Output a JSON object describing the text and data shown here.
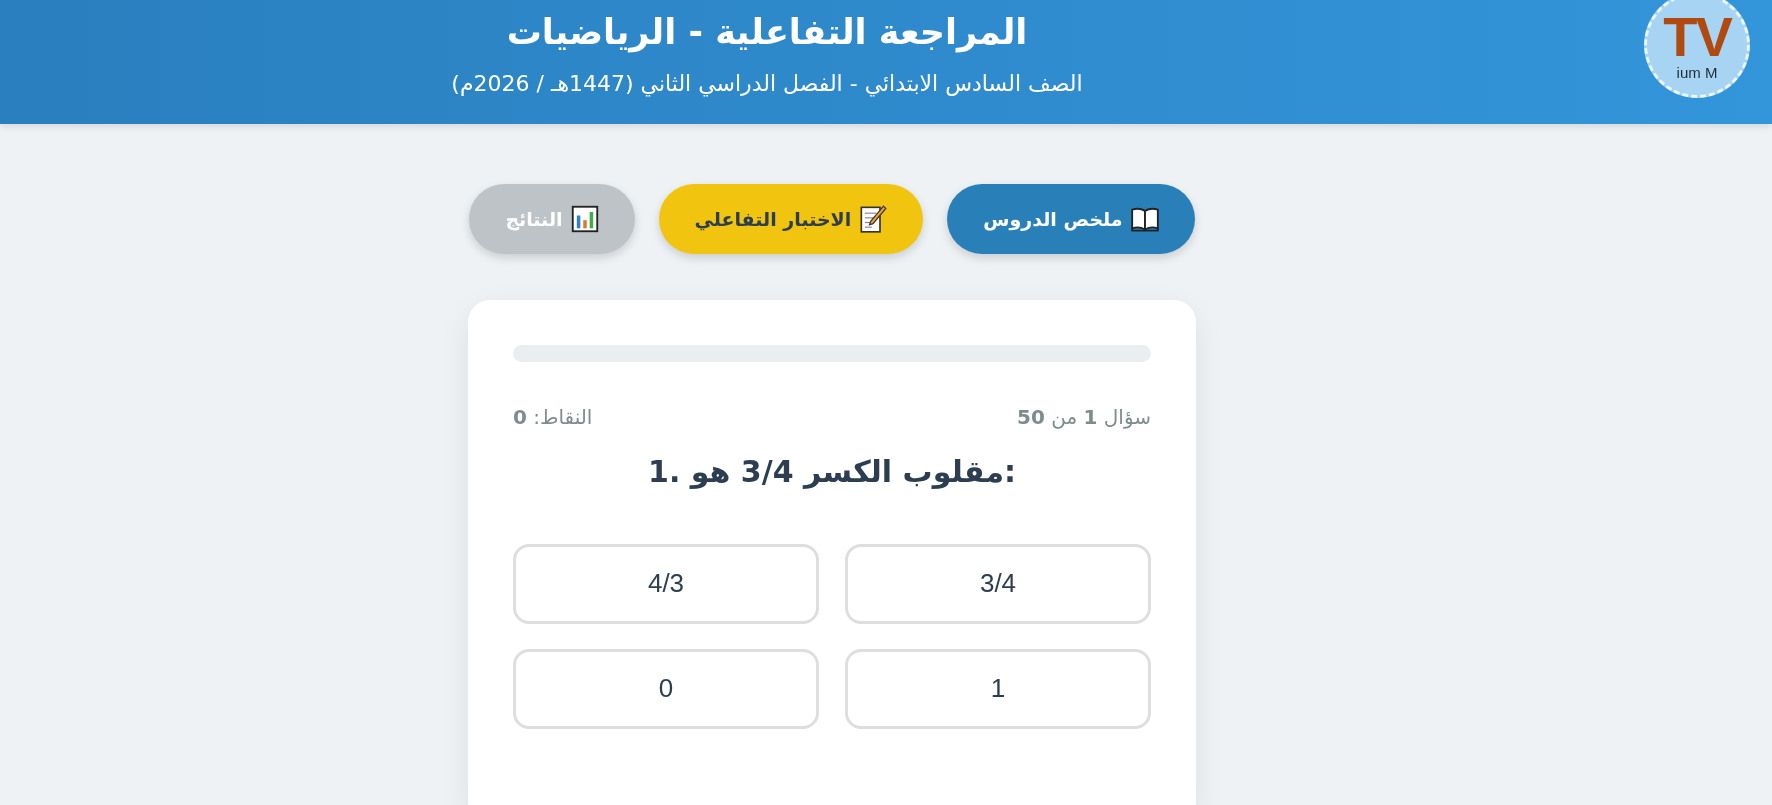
{
  "header": {
    "title": "المراجعة التفاعلية - الرياضيات",
    "subtitle": "الصف السادس الابتدائي - الفصل الدراسي الثاني (1447هـ / 2026م)",
    "logo": {
      "mark": "TV",
      "caption": "ium M"
    }
  },
  "tabs": [
    {
      "label": "ملخص الدروس",
      "color": "#2980b9",
      "selected": false
    },
    {
      "label": "الاختبار التفاعلي",
      "color": "#f1c40f",
      "selected": true
    },
    {
      "label": "النتائج",
      "color": "#bdc3c7",
      "selected": false
    }
  ],
  "quiz": {
    "progress": {
      "level": 0
    },
    "counter": "سؤال **1** من **50**",
    "score": "النقاط: **0**",
    "question": "1. مقلوب الكسر 3/4 هو:",
    "options": [
      {
        "label": "3/4",
        "selected": false
      },
      {
        "label": "4/3",
        "selected": false
      },
      {
        "label": "1",
        "selected": false
      },
      {
        "label": "0",
        "selected": false
      }
    ]
  }
}
